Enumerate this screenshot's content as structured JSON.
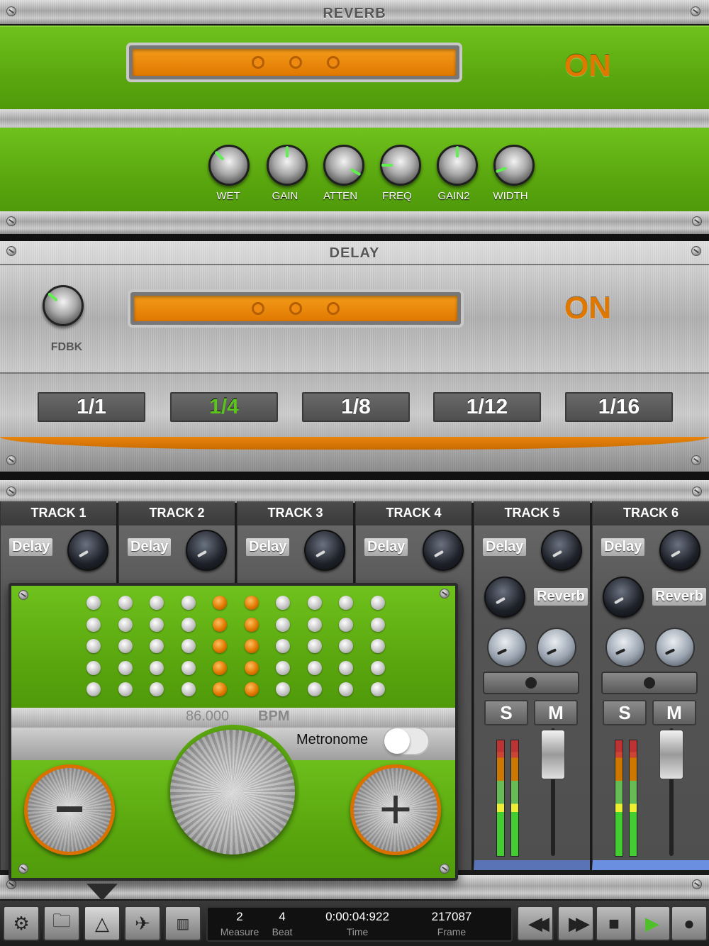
{
  "reverb": {
    "title": "REVERB",
    "status": "ON",
    "knobs": [
      {
        "label": "WET"
      },
      {
        "label": "GAIN"
      },
      {
        "label": "ATTEN"
      },
      {
        "label": "FREQ"
      },
      {
        "label": "GAIN2"
      },
      {
        "label": "WIDTH"
      }
    ]
  },
  "delay": {
    "title": "DELAY",
    "status": "ON",
    "fdbk_label": "FDBK",
    "divisions": [
      "1/1",
      "1/4",
      "1/8",
      "1/12",
      "1/16"
    ],
    "selected_division": "1/4"
  },
  "tracks": [
    {
      "name": "TRACK 1",
      "send": "Delay"
    },
    {
      "name": "TRACK 2",
      "send": "Delay"
    },
    {
      "name": "TRACK 3",
      "send": "Delay"
    },
    {
      "name": "TRACK 4",
      "send": "Delay"
    },
    {
      "name": "TRACK 5",
      "send": "Delay",
      "send2": "Reverb",
      "solo": "S",
      "mute": "M"
    },
    {
      "name": "TRACK 6",
      "send": "Delay",
      "send2": "Reverb",
      "solo": "S",
      "mute": "M"
    }
  ],
  "metronome": {
    "bpm_value": "86.000",
    "bpm_unit": "BPM",
    "toggle_label": "Metronome",
    "enabled": false,
    "minus": "−",
    "plus": "+"
  },
  "transport": {
    "measure": "2",
    "measure_label": "Measure",
    "beat": "4",
    "beat_label": "Beat",
    "time": "0:00:04:922",
    "time_label": "Time",
    "frame": "217087",
    "frame_label": "Frame"
  },
  "toolbar_icons": [
    "gear-icon",
    "folder-icon",
    "metronome-icon",
    "airplane-icon",
    "piano-icon",
    "rewind-icon",
    "fast-forward-icon",
    "stop-icon",
    "play-icon",
    "record-icon"
  ],
  "colors": {
    "accent_orange": "#e07800",
    "panel_green": "#5aa70f",
    "play_green": "#4fbf2a"
  }
}
